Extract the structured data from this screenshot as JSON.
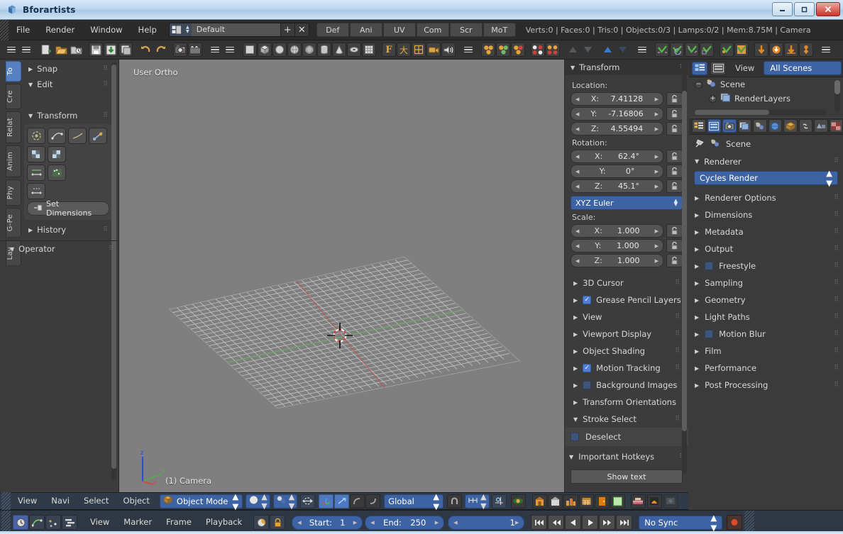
{
  "window": {
    "title": "Bforartists",
    "buttons": {
      "minimize": "—",
      "maximize": "❐",
      "close": "✕"
    }
  },
  "menubar": {
    "items": [
      "File",
      "Render",
      "Window",
      "Help"
    ],
    "screen_layout": {
      "value": "Default",
      "add": "+",
      "remove": "✕"
    },
    "layout_tabs": [
      "Def",
      "Ani",
      "UV",
      "Com",
      "Scr",
      "MoT"
    ],
    "stats": "Verts:0 | Faces:0 | Tris:0 | Objects:0/3 | Lamps:0/2 | Mem:8.75M | Camera"
  },
  "toolbar": {
    "groups": [
      {
        "name": "menus",
        "icons": [
          "hamburger-icon",
          "hamburger-icon"
        ]
      },
      {
        "name": "file",
        "icons": [
          "new-file-icon",
          "open-file-icon",
          "open-recent-icon"
        ]
      },
      {
        "name": "save",
        "icons": [
          "save-icon",
          "save-as-icon",
          "save-copy-icon"
        ]
      },
      {
        "name": "undo",
        "icons": [
          "undo-icon",
          "redo-icon"
        ]
      },
      {
        "name": "render",
        "icons": [
          "render-image-icon",
          "render-animation-icon"
        ]
      },
      {
        "name": "menus2",
        "icons": [
          "hamburger-icon",
          "hamburger-icon"
        ]
      },
      {
        "name": "primitives",
        "icons": [
          "plane-icon",
          "cube-icon",
          "circle-icon",
          "uvsphere-icon",
          "icosphere-icon",
          "cylinder-icon",
          "cone-icon",
          "torus-icon",
          "grid-icon"
        ]
      },
      {
        "name": "objects",
        "icons": [
          "text-icon",
          "armature-icon",
          "lattice-icon",
          "camera-icon",
          "speaker-icon"
        ]
      },
      {
        "name": "menus3",
        "icons": [
          "hamburger-icon"
        ]
      },
      {
        "name": "select",
        "icons": [
          "select-all-icon",
          "select-inverse-icon",
          "select-random-icon"
        ]
      },
      {
        "name": "select2",
        "icons": [
          "select-linked-icon",
          "select-grouped-icon"
        ]
      },
      {
        "name": "select3",
        "icons": [
          "select-more-icon",
          "select-less-icon"
        ]
      },
      {
        "name": "transform",
        "icons": [
          "move-icon",
          "rotate-icon"
        ]
      },
      {
        "name": "menus4",
        "icons": [
          "hamburger-icon"
        ]
      },
      {
        "name": "apply",
        "icons": [
          "apply-a-icon",
          "apply-b-icon",
          "apply-c-icon",
          "apply-d-icon"
        ]
      },
      {
        "name": "snap",
        "icons": [
          "snap-cursor-icon",
          "snap-selection-icon"
        ]
      },
      {
        "name": "origin",
        "icons": [
          "origin-a-icon",
          "origin-b-icon",
          "origin-c-icon",
          "origin-d-icon"
        ]
      },
      {
        "name": "menus5",
        "icons": [
          "hamburger-icon"
        ]
      },
      {
        "name": "rotate",
        "icons": [
          "rotate-left-icon",
          "rotate-right-icon"
        ]
      }
    ]
  },
  "toolshelf": {
    "tabs": [
      {
        "label": "To",
        "active": true
      },
      {
        "label": "Cre",
        "active": false
      },
      {
        "label": "Relat",
        "active": false
      },
      {
        "label": "Anim",
        "active": false
      },
      {
        "label": "Phy",
        "active": false
      },
      {
        "label": "G-Pe",
        "active": false
      },
      {
        "label": "Lay",
        "active": false
      }
    ],
    "panels": [
      {
        "label": "Snap",
        "open": false
      },
      {
        "label": "Edit",
        "open": true
      },
      {
        "label": "Transform",
        "open": true
      },
      {
        "label": "History",
        "open": false
      }
    ],
    "transform_tools": [
      "translate-icon",
      "rotate-icon",
      "scale-icon",
      "mirror-icon",
      "tosphere-icon",
      "shear-icon",
      "warp-icon",
      "randomize-icon",
      "push-pull-icon"
    ],
    "set_dimensions": "Set Dimensions",
    "operator_panel": "Operator"
  },
  "viewport": {
    "view_label": "User Ortho",
    "camera_label": "(1) Camera",
    "axis_gizmo": {
      "z": "z",
      "y": "y",
      "x": "x"
    }
  },
  "npanel": {
    "transform_header": "Transform",
    "location_label": "Location:",
    "location": [
      {
        "axis": "X:",
        "value": "7.41128"
      },
      {
        "axis": "Y:",
        "value": "-7.16806"
      },
      {
        "axis": "Z:",
        "value": "4.55494"
      }
    ],
    "rotation_label": "Rotation:",
    "rotation": [
      {
        "axis": "X:",
        "value": "62.4°"
      },
      {
        "axis": "Y:",
        "value": "0°"
      },
      {
        "axis": "Z:",
        "value": "45.1°"
      }
    ],
    "rotation_mode": "XYZ Euler",
    "scale_label": "Scale:",
    "scale": [
      {
        "axis": "X:",
        "value": "1.000"
      },
      {
        "axis": "Y:",
        "value": "1.000"
      },
      {
        "axis": "Z:",
        "value": "1.000"
      }
    ],
    "panels": [
      {
        "label": "3D Cursor",
        "checkbox": null,
        "open": false,
        "dots": true
      },
      {
        "label": "Grease Pencil Layers",
        "checkbox": "on",
        "open": false,
        "dots": false
      },
      {
        "label": "View",
        "checkbox": null,
        "open": false,
        "dots": true
      },
      {
        "label": "Viewport Display",
        "checkbox": null,
        "open": false,
        "dots": true
      },
      {
        "label": "Object Shading",
        "checkbox": null,
        "open": false,
        "dots": true
      },
      {
        "label": "Motion Tracking",
        "checkbox": "on",
        "open": false,
        "dots": true
      },
      {
        "label": "Background Images",
        "checkbox": "off",
        "open": false,
        "dots": false
      },
      {
        "label": "Transform Orientations",
        "checkbox": null,
        "open": false,
        "dots": false
      },
      {
        "label": "Stroke Select",
        "checkbox": null,
        "open": true,
        "dots": true
      }
    ],
    "deselect": "Deselect",
    "hotkeys_header": "Important Hotkeys",
    "show_text": "Show text"
  },
  "outliner": {
    "view_menu": "View",
    "filter": "All Scenes",
    "rows": [
      {
        "label": "Scene",
        "indent": 0,
        "expander": "−",
        "icon": "scene-icon"
      },
      {
        "label": "RenderLayers",
        "indent": 1,
        "expander": "+",
        "icon": "renderlayers-icon"
      }
    ]
  },
  "properties": {
    "tabs": [
      "render-tab",
      "renderlayers-tab",
      "scene-tab",
      "world-tab",
      "object-tab",
      "constraints-tab",
      "modifiers-tab",
      "texture-tab"
    ],
    "breadcrumb": "Scene",
    "header": "Renderer",
    "engine": "Cycles Render",
    "panels": [
      {
        "label": "Renderer Options",
        "checkbox": null
      },
      {
        "label": "Dimensions",
        "checkbox": null
      },
      {
        "label": "Metadata",
        "checkbox": null
      },
      {
        "label": "Output",
        "checkbox": null
      },
      {
        "label": "Freestyle",
        "checkbox": "off"
      },
      {
        "label": "Sampling",
        "checkbox": null
      },
      {
        "label": "Geometry",
        "checkbox": null
      },
      {
        "label": "Light Paths",
        "checkbox": null
      },
      {
        "label": "Motion Blur",
        "checkbox": "off"
      },
      {
        "label": "Film",
        "checkbox": null
      },
      {
        "label": "Performance",
        "checkbox": null
      },
      {
        "label": "Post Processing",
        "checkbox": null
      }
    ]
  },
  "view_header": {
    "menus": [
      "View",
      "Navi",
      "Select",
      "Object"
    ],
    "mode": "Object Mode",
    "orientation": "Global",
    "shading_icon": "solid-shading-icon",
    "pivot_icon": "pivot-median-icon",
    "manipulator_icons": [
      "translate-manipulator-icon",
      "rotate-manipulator-icon",
      "scale-manipulator-icon"
    ],
    "snap_icon": "magnet-icon",
    "proportional_icon": "proportional-edit-icon",
    "render_icon": "opengl-render-icon",
    "layer_icons": [
      "layer-1-icon",
      "layer-2-icon",
      "layer-3-icon",
      "layer-4-icon",
      "layer-5-icon",
      "layer-6-icon"
    ],
    "extra_icons": [
      "render-scene-icon",
      "browse-scene-icon",
      "lock-camera-icon"
    ]
  },
  "timeline": {
    "editor_icons": [
      "timeline-editor-icon",
      "graph-editor-icon",
      "dopesheet-icon",
      "nla-icon"
    ],
    "menus": [
      "View",
      "Marker",
      "Frame",
      "Playback"
    ],
    "toggle_icons": [
      "only-selected-icon",
      "lock-icon"
    ],
    "start_label": "Start:",
    "start_value": "1",
    "end_label": "End:",
    "end_value": "250",
    "current_frame": "1",
    "transport": [
      "jump-start-icon",
      "step-back-icon",
      "play-reverse-icon",
      "play-icon",
      "step-forward-icon",
      "jump-end-icon"
    ],
    "sync": "No Sync",
    "record_icon": "record-icon"
  },
  "colors": {
    "accent_blue": "#3d63a5",
    "viewport_bg": "#7f7f7f",
    "panel_bg": "#3c3c3c",
    "header_bg": "#333333",
    "axis_x": "#c84d4d",
    "axis_y": "#5da555",
    "axis_z": "#2f4bd0",
    "title_bar": "#bdd7ef"
  }
}
